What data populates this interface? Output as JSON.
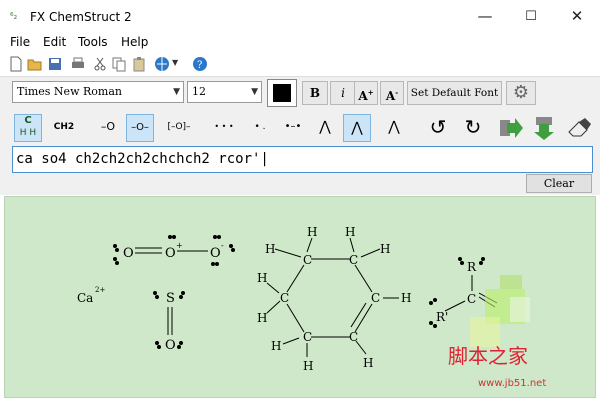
{
  "window": {
    "title": "FX ChemStruct 2",
    "min": "—",
    "max": "☐",
    "close": "✕"
  },
  "menu": [
    "File",
    "Edit",
    "Tools",
    "Help"
  ],
  "font": {
    "name": "Times New Roman",
    "size": "12",
    "bold": "B",
    "italic": "i",
    "grow": "A",
    "shrink": "A",
    "default_btn": "Set Default Font"
  },
  "symbols": {
    "c_hydro": "C",
    "ch2": "CH2",
    "dash_o": "–O",
    "dash_o_minus": "–O–",
    "bracket_o": "[–O]–",
    "dots3": "• • •",
    "dots2": "• .",
    "bond": "•–•",
    "caret": "⋀",
    "caret_dots": "⋀",
    "caret_dots2": "⋀"
  },
  "input": {
    "value": "ca so4 ch2ch2ch2chchch2 rcor'|"
  },
  "clear_label": "Clear",
  "molecules": {
    "ozone": {
      "a1": "O",
      "a2": "O",
      "a3": "O",
      "c1": "+",
      "c3": "-"
    },
    "ca": {
      "label": "Ca",
      "charge": "2+"
    },
    "so": {
      "s": "S",
      "o": "O"
    },
    "ring": {
      "c": "C",
      "h": "H"
    },
    "ketone": {
      "r": "R",
      "c": "C",
      "rp": "R'"
    }
  },
  "watermark": {
    "text": "脚本之家",
    "url": "www.jb51.net"
  }
}
